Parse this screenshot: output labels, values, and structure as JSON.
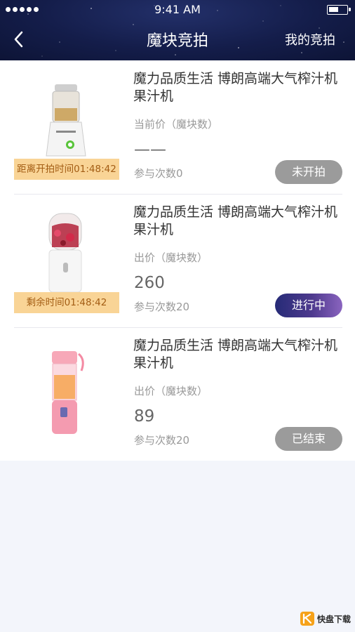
{
  "status_bar": {
    "time": "9:41 AM"
  },
  "nav": {
    "title": "魔块竞拍",
    "right_link": "我的竞拍"
  },
  "items": [
    {
      "title": "魔力品质生活 博朗高端大气榨汁机果汁机",
      "price_label": "当前价（魔块数）",
      "price": "——",
      "count_text": "参与次数0",
      "timer_text": "距离开拍时间01:48:42",
      "status_button": "未开拍",
      "status_color": "#9b9b9b"
    },
    {
      "title": "魔力品质生活 博朗高端大气榨汁机果汁机",
      "price_label": "出价（魔块数）",
      "price": "260",
      "count_text": "参与次数20",
      "timer_text": "剩余时间01:48:42",
      "status_button": "进行中",
      "status_color": "#262b77"
    },
    {
      "title": "魔力品质生活 博朗高端大气榨汁机果汁机",
      "price_label": "出价（魔块数）",
      "price": "89",
      "count_text": "参与次数20",
      "timer_text": "",
      "status_button": "已结束",
      "status_color": "#9b9b9b"
    }
  ],
  "watermark": {
    "brand": "快盘下载"
  },
  "colors": {
    "header_bg": "#141d4a",
    "timer_bg": "#f9d496",
    "timer_text": "#a35d14"
  }
}
